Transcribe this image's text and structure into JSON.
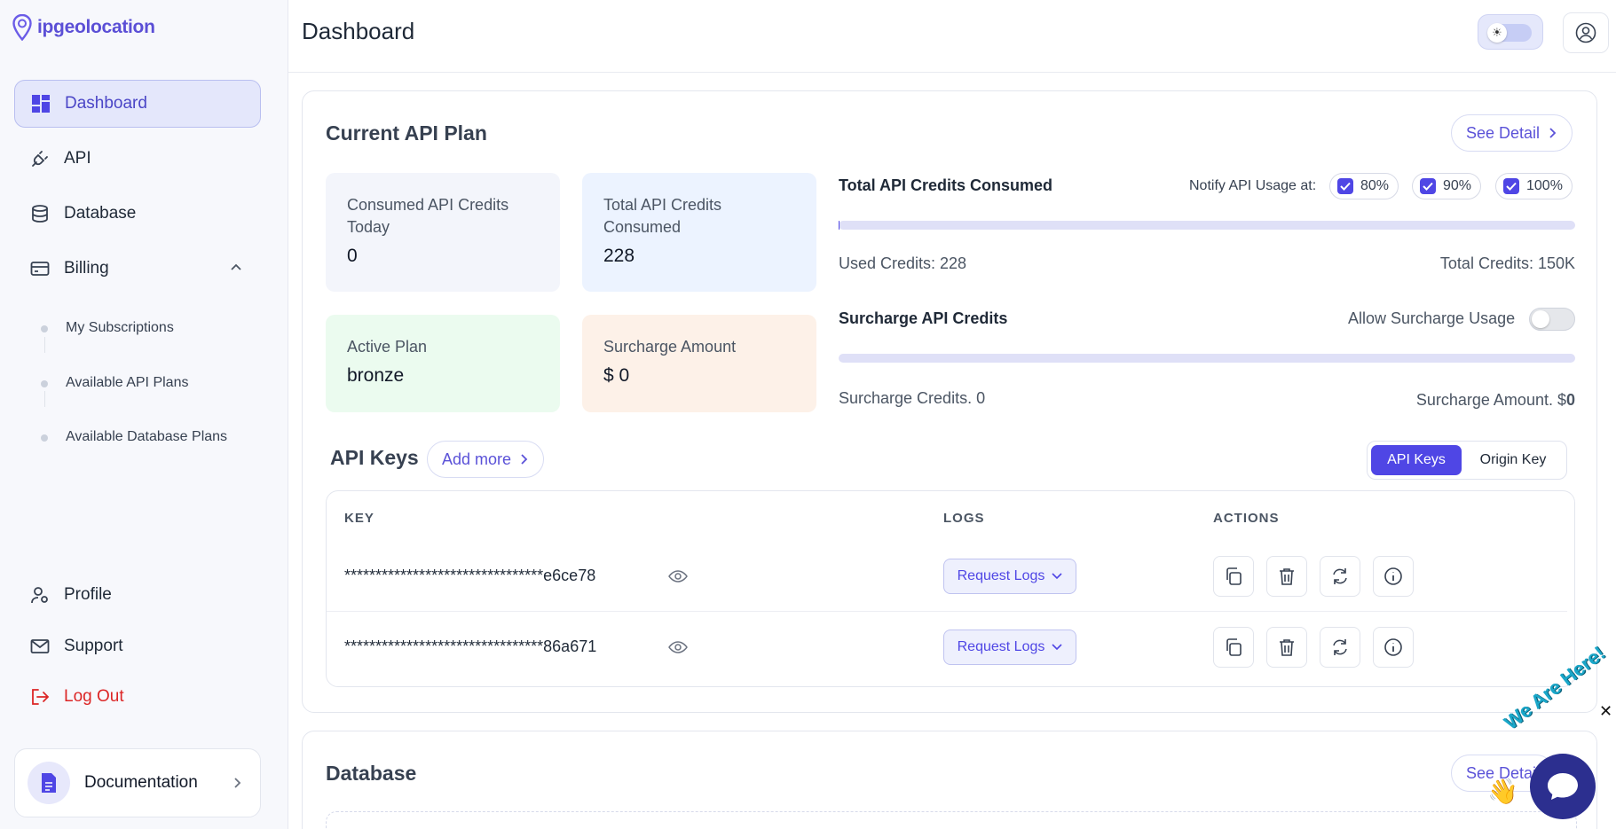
{
  "app": {
    "brand": "ipgeolocation",
    "accent": "#4f46e5"
  },
  "sidebar": {
    "items": [
      {
        "label": "Dashboard",
        "icon": "dashboard-icon"
      },
      {
        "label": "API",
        "icon": "plug-icon"
      },
      {
        "label": "Database",
        "icon": "database-icon"
      },
      {
        "label": "Billing",
        "icon": "credit-card-icon"
      }
    ],
    "billing_sub": [
      "My Subscriptions",
      "Available API Plans",
      "Available Database Plans"
    ],
    "bottom": [
      {
        "label": "Profile",
        "icon": "user-gear-icon"
      },
      {
        "label": "Support",
        "icon": "mail-icon"
      },
      {
        "label": "Log Out",
        "icon": "logout-icon"
      }
    ],
    "documentation": "Documentation"
  },
  "header": {
    "title": "Dashboard",
    "theme_icon": "☀"
  },
  "plan": {
    "title": "Current API Plan",
    "see_detail": "See Detail",
    "stats": {
      "consumed_today_label": "Consumed API Credits Today",
      "consumed_today_value": "0",
      "total_consumed_label": "Total API Credits Consumed",
      "total_consumed_value": "228",
      "active_plan_label": "Active Plan",
      "active_plan_value": "bronze",
      "surcharge_amount_label": "Surcharge Amount",
      "surcharge_amount_value": "$ 0"
    },
    "usage": {
      "title": "Total API Credits Consumed",
      "notify_label": "Notify API Usage at:",
      "thresholds": [
        "80%",
        "90%",
        "100%"
      ],
      "used": "Used Credits: 228",
      "total": "Total Credits: 150K",
      "progress": 0.0015
    },
    "surcharge": {
      "title": "Surcharge API Credits",
      "allow_label": "Allow Surcharge Usage",
      "allow_enabled": false,
      "credits": "Surcharge Credits. 0",
      "amount_prefix": "Surcharge Amount. $",
      "amount_value": "0",
      "progress": 0
    }
  },
  "api_keys": {
    "title": "API Keys",
    "add_more": "Add more",
    "toggle": [
      "API Keys",
      "Origin Key"
    ],
    "columns": [
      "KEY",
      "LOGS",
      "ACTIONS"
    ],
    "rows": [
      {
        "key": "********************************e6ce78",
        "logs": "Request Logs"
      },
      {
        "key": "********************************86a671",
        "logs": "Request Logs"
      }
    ]
  },
  "database": {
    "title": "Database",
    "see_detail": "See Detail"
  },
  "chat": {
    "tag": "We Are Here!",
    "wave": "👋",
    "close": "✕"
  }
}
